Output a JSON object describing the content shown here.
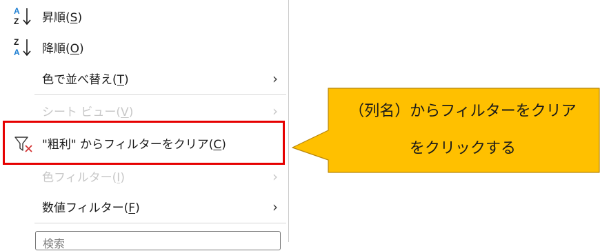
{
  "menu": {
    "sort_asc": {
      "label_main": "昇順(",
      "mnemonic": "S",
      "label_end": ")"
    },
    "sort_desc": {
      "label_main": "降順(",
      "mnemonic": "O",
      "label_end": ")"
    },
    "sort_by_color": {
      "label_main": "色で並べ替え(",
      "mnemonic": "T",
      "label_end": ")"
    },
    "sheet_view": {
      "label_main": "シート ビュー(",
      "mnemonic": "V",
      "label_end": ")"
    },
    "clear_filter": {
      "label_main": "\"粗利\" からフィルターをクリア(",
      "mnemonic": "C",
      "label_end": ")"
    },
    "color_filter": {
      "label_main": "色フィルター(",
      "mnemonic": "I",
      "label_end": ")"
    },
    "number_filter": {
      "label_main": "数値フィルター(",
      "mnemonic": "F",
      "label_end": ")"
    },
    "search": {
      "placeholder": "検索"
    }
  },
  "callout": {
    "line1": "（列名）からフィルターをクリア",
    "line2": "をクリックする"
  },
  "colors": {
    "highlight": "#e60000",
    "callout_fill": "#ffc000",
    "sort_blue": "#1e7fd2",
    "filter_x": "#d32f2f"
  }
}
